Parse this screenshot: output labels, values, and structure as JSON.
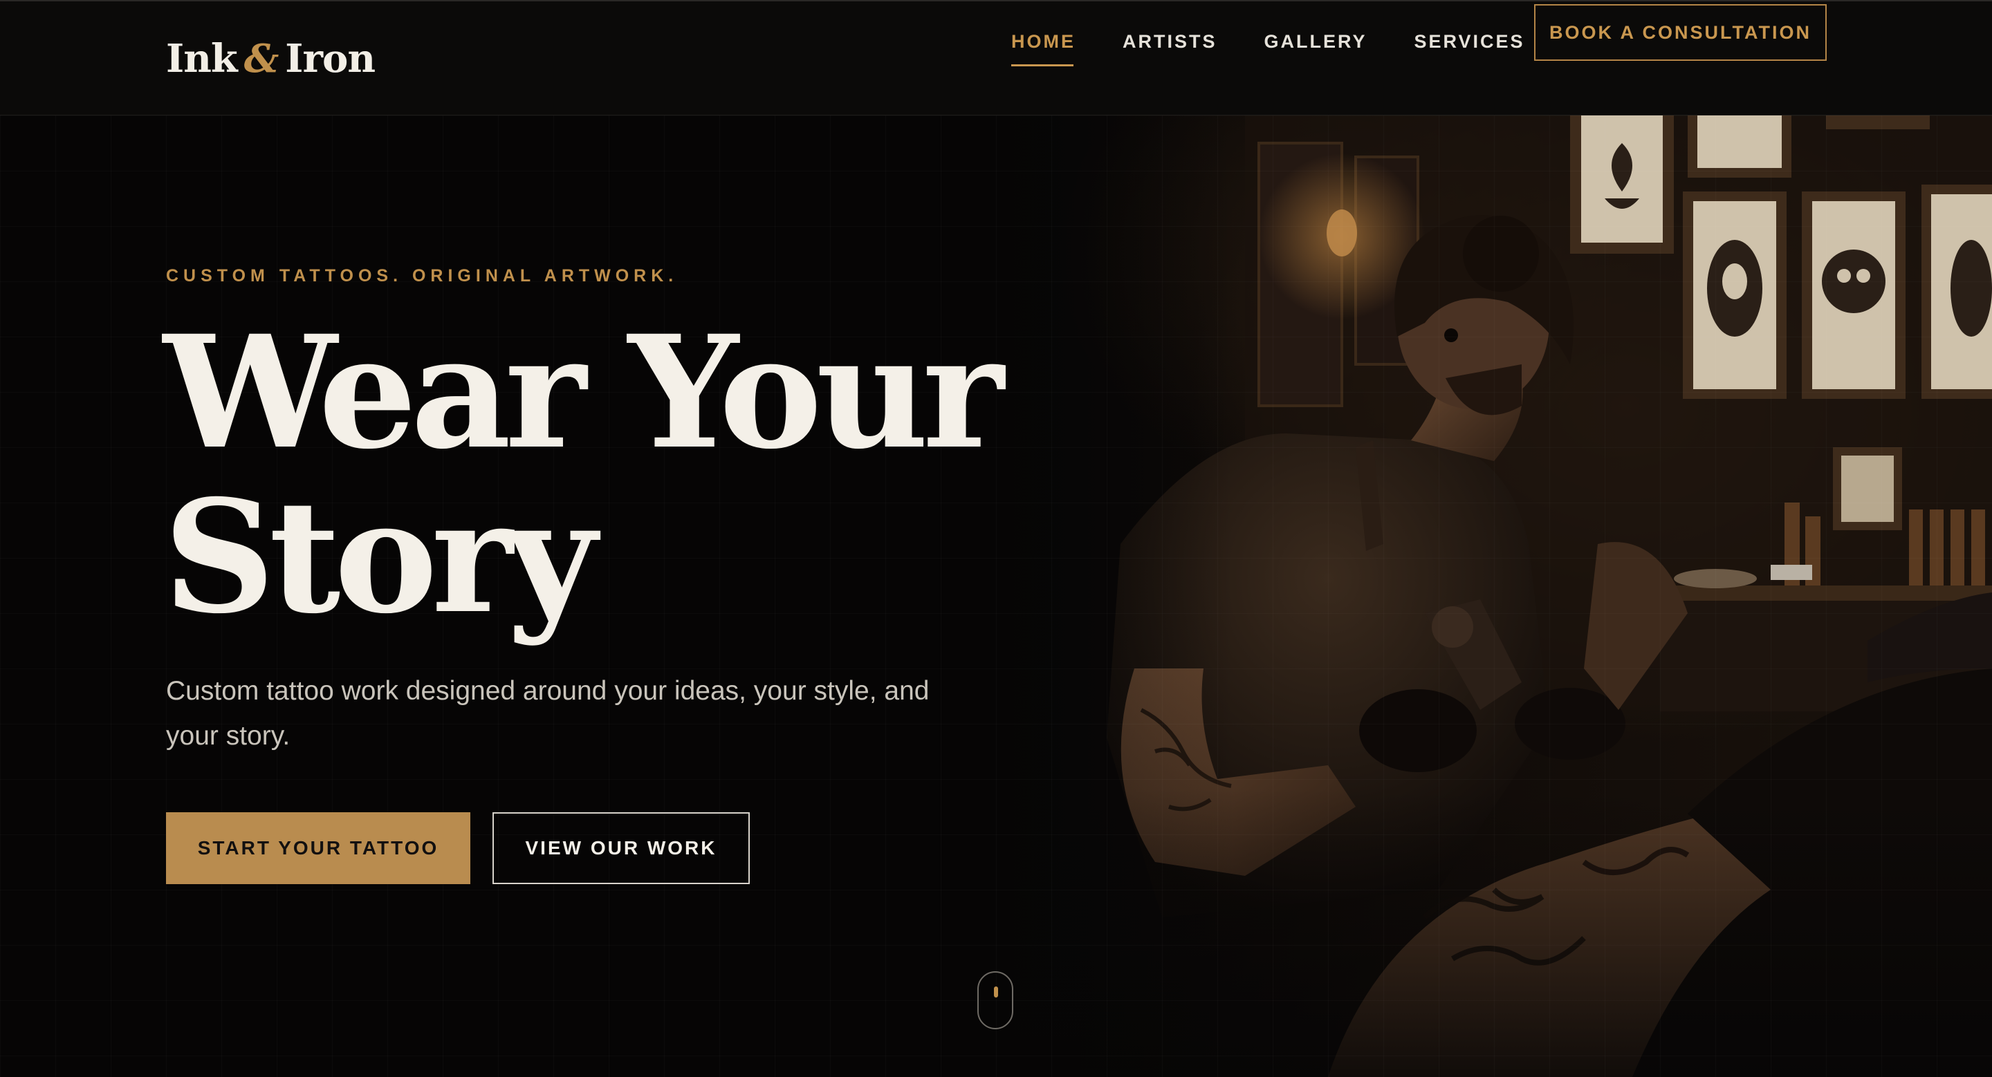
{
  "header": {
    "logo": {
      "part1": "Ink",
      "amp": "&",
      "part2": "Iron"
    },
    "nav": [
      {
        "label": "HOME",
        "active": true
      },
      {
        "label": "ARTISTS",
        "active": false
      },
      {
        "label": "GALLERY",
        "active": false
      },
      {
        "label": "SERVICES",
        "active": false
      }
    ],
    "cta_label": "BOOK A CONSULTATION"
  },
  "hero": {
    "eyebrow": "CUSTOM TATTOOS. ORIGINAL ARTWORK.",
    "headline_line1": "Wear Your",
    "headline_line2": "Story",
    "subtext": "Custom tattoo work designed around your ideas, your style, and your story.",
    "primary_button": "START YOUR TATTOO",
    "secondary_button": "VIEW OUR WORK"
  },
  "colors": {
    "accent": "#c0904c",
    "background": "#060505",
    "text": "#f4f0e8"
  }
}
